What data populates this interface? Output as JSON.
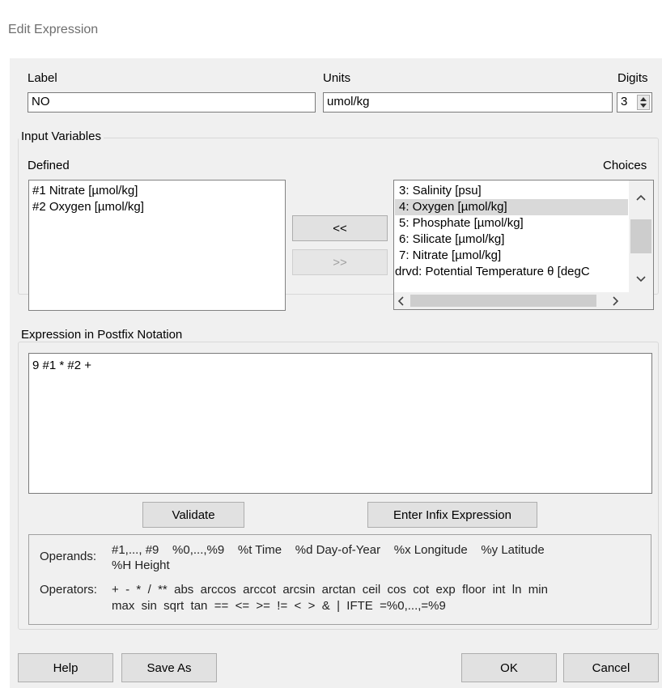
{
  "window": {
    "title": "Edit Expression"
  },
  "fields": {
    "label_caption": "Label",
    "label_value": "NO",
    "units_caption": "Units",
    "units_value": "umol/kg",
    "digits_caption": "Digits",
    "digits_value": "3"
  },
  "input_variables": {
    "group_title": "Input Variables",
    "defined_caption": "Defined",
    "choices_caption": "Choices",
    "defined_items": [
      "#1 Nitrate [µmol/kg]",
      "#2 Oxygen [µmol/kg]"
    ],
    "choices_items": [
      "  3: Salinity [psu]",
      "  4: Oxygen [µmol/kg]",
      "  5: Phosphate [µmol/kg]",
      "  6: Silicate [µmol/kg]",
      "  7: Nitrate [µmol/kg]",
      "drvd: Potential Temperature θ [degC"
    ],
    "choices_selected_index": 1,
    "add_button": "<<",
    "remove_button": ">>"
  },
  "expression": {
    "group_title": "Expression in Postfix Notation",
    "value": "9 #1 * #2 +",
    "validate_button": "Validate",
    "infix_button": "Enter Infix Expression"
  },
  "help_info": {
    "operands_caption": "Operands:",
    "operands_line1": "#1,..., #9    %0,...,%9    %t Time    %d Day-of-Year    %x Longitude    %y Latitude",
    "operands_line2": "%H Height",
    "operators_caption": "Operators:",
    "operators_line1": "+  -  *  /  **  abs  arccos  arccot  arcsin  arctan  ceil  cos  cot  exp  floor  int  ln  min",
    "operators_line2": "max  sin  sqrt  tan  ==  <=  >=  !=  <  >  &  |  IFTE  =%0,...,=%9"
  },
  "footer": {
    "help_button": "Help",
    "save_as_button": "Save As",
    "ok_button": "OK",
    "cancel_button": "Cancel"
  }
}
